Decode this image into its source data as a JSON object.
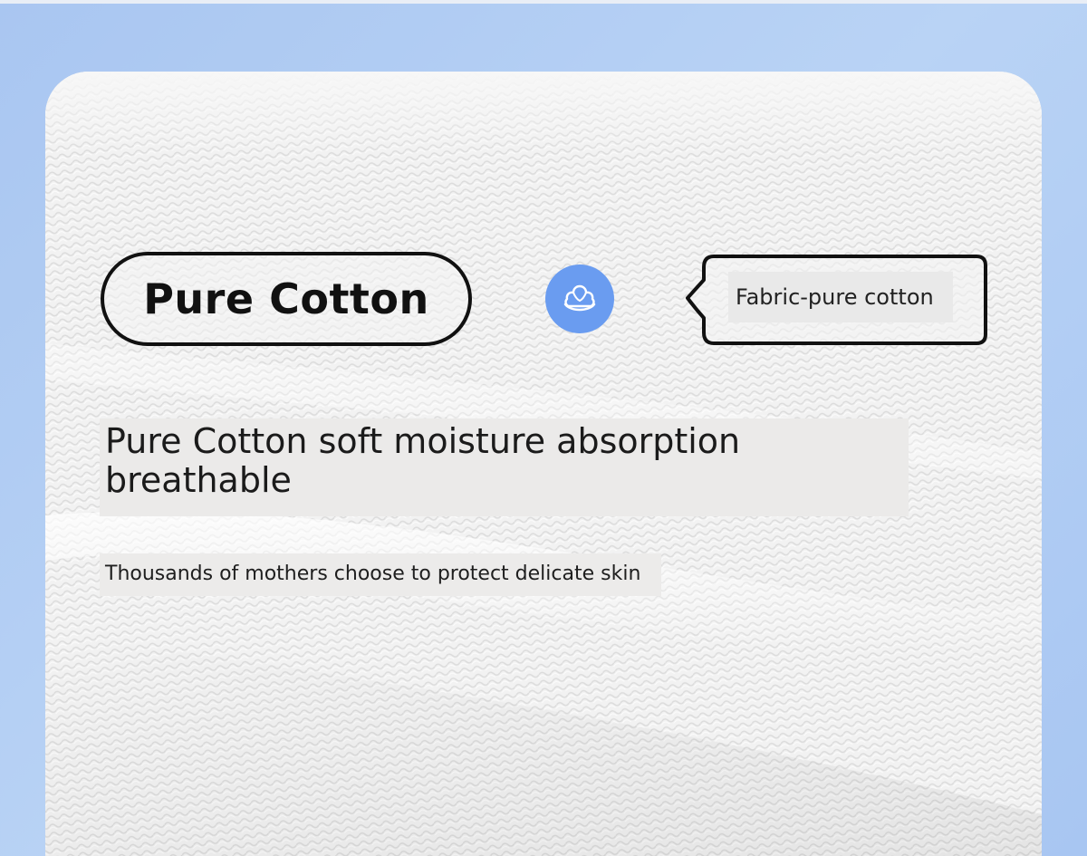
{
  "badge": {
    "label": "Pure Cotton"
  },
  "icon": {
    "name": "cotton-flower-icon",
    "circle_color": "#6a9cf0"
  },
  "callout": {
    "text": "Fabric-pure cotton"
  },
  "headline": {
    "text": "Pure Cotton soft moisture absorption breathable"
  },
  "subheadline": {
    "text": "Thousands of mothers choose to protect delicate skin"
  },
  "colors": {
    "background_blue": "#a9c6f1",
    "card": "#f4f4f4",
    "outline": "#111111"
  }
}
